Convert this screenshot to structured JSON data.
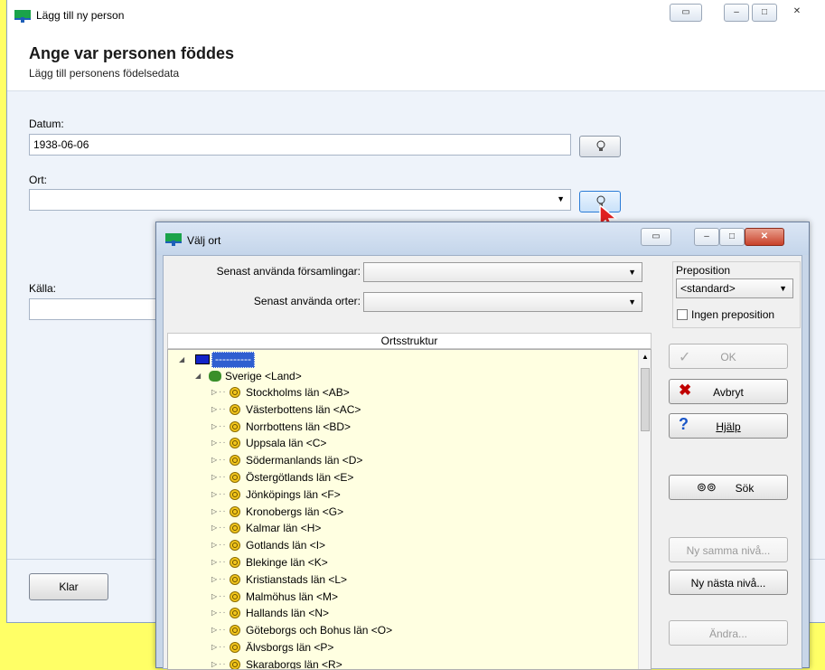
{
  "main_window": {
    "title": "Lägg till ny person",
    "header_title": "Ange var personen föddes",
    "header_subtitle": "Lägg till personens födelsedata",
    "date_label": "Datum:",
    "date_value": "1938-06-06",
    "place_label": "Ort:",
    "place_value": "",
    "source_label": "Källa:",
    "done_button": "Klar"
  },
  "dialog": {
    "title": "Välj ort",
    "recent_parishes_label": "Senast använda församlingar:",
    "recent_parishes_value": "",
    "recent_places_label": "Senast använda orter:",
    "recent_places_value": "",
    "preposition_group": "Preposition",
    "preposition_value": "<standard>",
    "no_preposition_label": "Ingen preposition",
    "no_preposition_checked": false,
    "tree_header": "Ortsstruktur",
    "tree_root": "----------",
    "tree_country": "Sverige <Land>",
    "tree_items": [
      "Stockholms län <AB>",
      "Västerbottens län <AC>",
      "Norrbottens län <BD>",
      "Uppsala län <C>",
      "Södermanlands län <D>",
      "Östergötlands län <E>",
      "Jönköpings län <F>",
      "Kronobergs län <G>",
      "Kalmar län <H>",
      "Gotlands län <I>",
      "Blekinge län <K>",
      "Kristianstads län <L>",
      "Malmöhus län <M>",
      "Hallands län <N>",
      "Göteborgs och Bohus län <O>",
      "Älvsborgs län <P>",
      "Skaraborgs län <R>"
    ],
    "buttons": {
      "ok": "OK",
      "cancel": "Avbryt",
      "help": "Hjälp",
      "search": "Sök",
      "new_same_level": "Ny samma nivå...",
      "new_next_level": "Ny nästa nivå...",
      "edit": "Ändra..."
    }
  },
  "colors": {
    "background": "#ffff66",
    "tree_background": "#ffffe1",
    "cancel_x": "#c00000",
    "help_q": "#1a56c8"
  }
}
